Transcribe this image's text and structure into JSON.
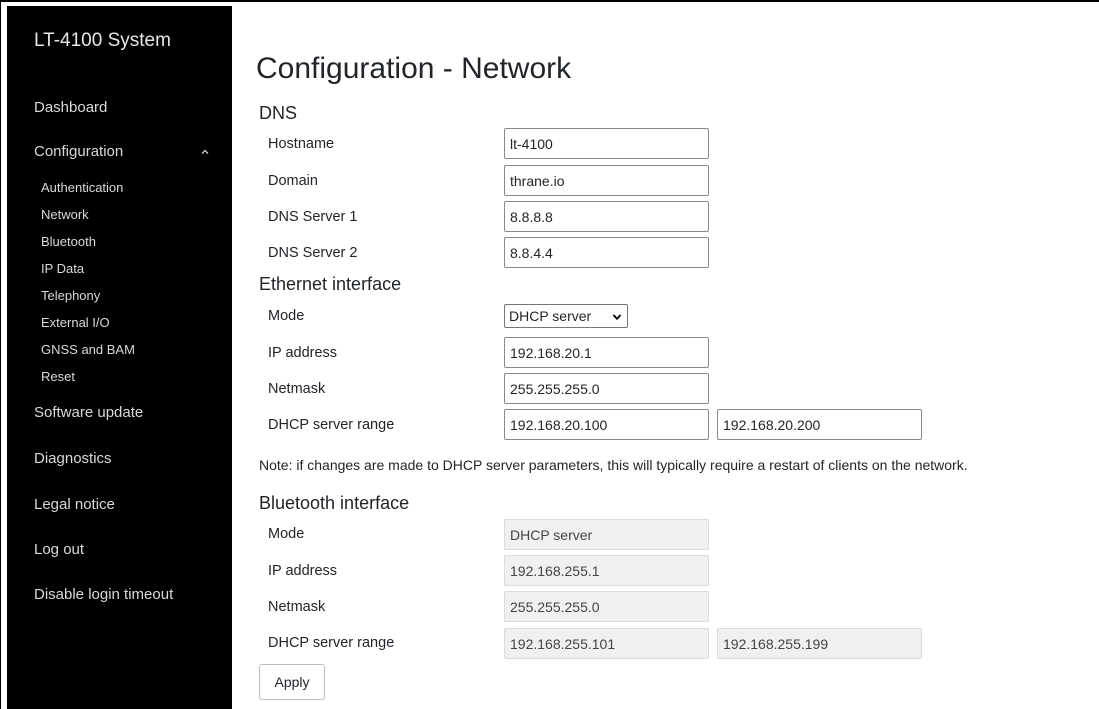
{
  "sidebar": {
    "brand": "LT-4100 System",
    "dashboard": "Dashboard",
    "configuration": "Configuration",
    "config_items": [
      "Authentication",
      "Network",
      "Bluetooth",
      "IP Data",
      "Telephony",
      "External I/O",
      "GNSS and BAM",
      "Reset"
    ],
    "software_update": "Software update",
    "diagnostics": "Diagnostics",
    "legal_notice": "Legal notice",
    "log_out": "Log out",
    "disable_login_timeout": "Disable login timeout"
  },
  "main": {
    "title": "Configuration - Network",
    "dns": {
      "heading": "DNS",
      "hostname_label": "Hostname",
      "hostname_value": "lt-4100",
      "domain_label": "Domain",
      "domain_value": "thrane.io",
      "dns1_label": "DNS Server 1",
      "dns1_value": "8.8.8.8",
      "dns2_label": "DNS Server 2",
      "dns2_value": "8.8.4.4"
    },
    "ethernet": {
      "heading": "Ethernet interface",
      "mode_label": "Mode",
      "mode_value": "DHCP server",
      "ip_label": "IP address",
      "ip_value": "192.168.20.1",
      "netmask_label": "Netmask",
      "netmask_value": "255.255.255.0",
      "range_label": "DHCP server range",
      "range_start": "192.168.20.100",
      "range_end": "192.168.20.200"
    },
    "note": "Note: if changes are made to DHCP server parameters, this will typically require a restart of clients on the network.",
    "bluetooth": {
      "heading": "Bluetooth interface",
      "mode_label": "Mode",
      "mode_value": "DHCP server",
      "ip_label": "IP address",
      "ip_value": "192.168.255.1",
      "netmask_label": "Netmask",
      "netmask_value": "255.255.255.0",
      "range_label": "DHCP server range",
      "range_start": "192.168.255.101",
      "range_end": "192.168.255.199"
    },
    "apply_label": "Apply"
  },
  "icons": {
    "config_chevron": "chevron-up-icon",
    "select_chevron": "chevron-down-icon"
  },
  "colors": {
    "sidebar_bg": "#000000",
    "sidebar_text": "#d9d9d9",
    "readonly_bg": "#f0f0f0"
  }
}
